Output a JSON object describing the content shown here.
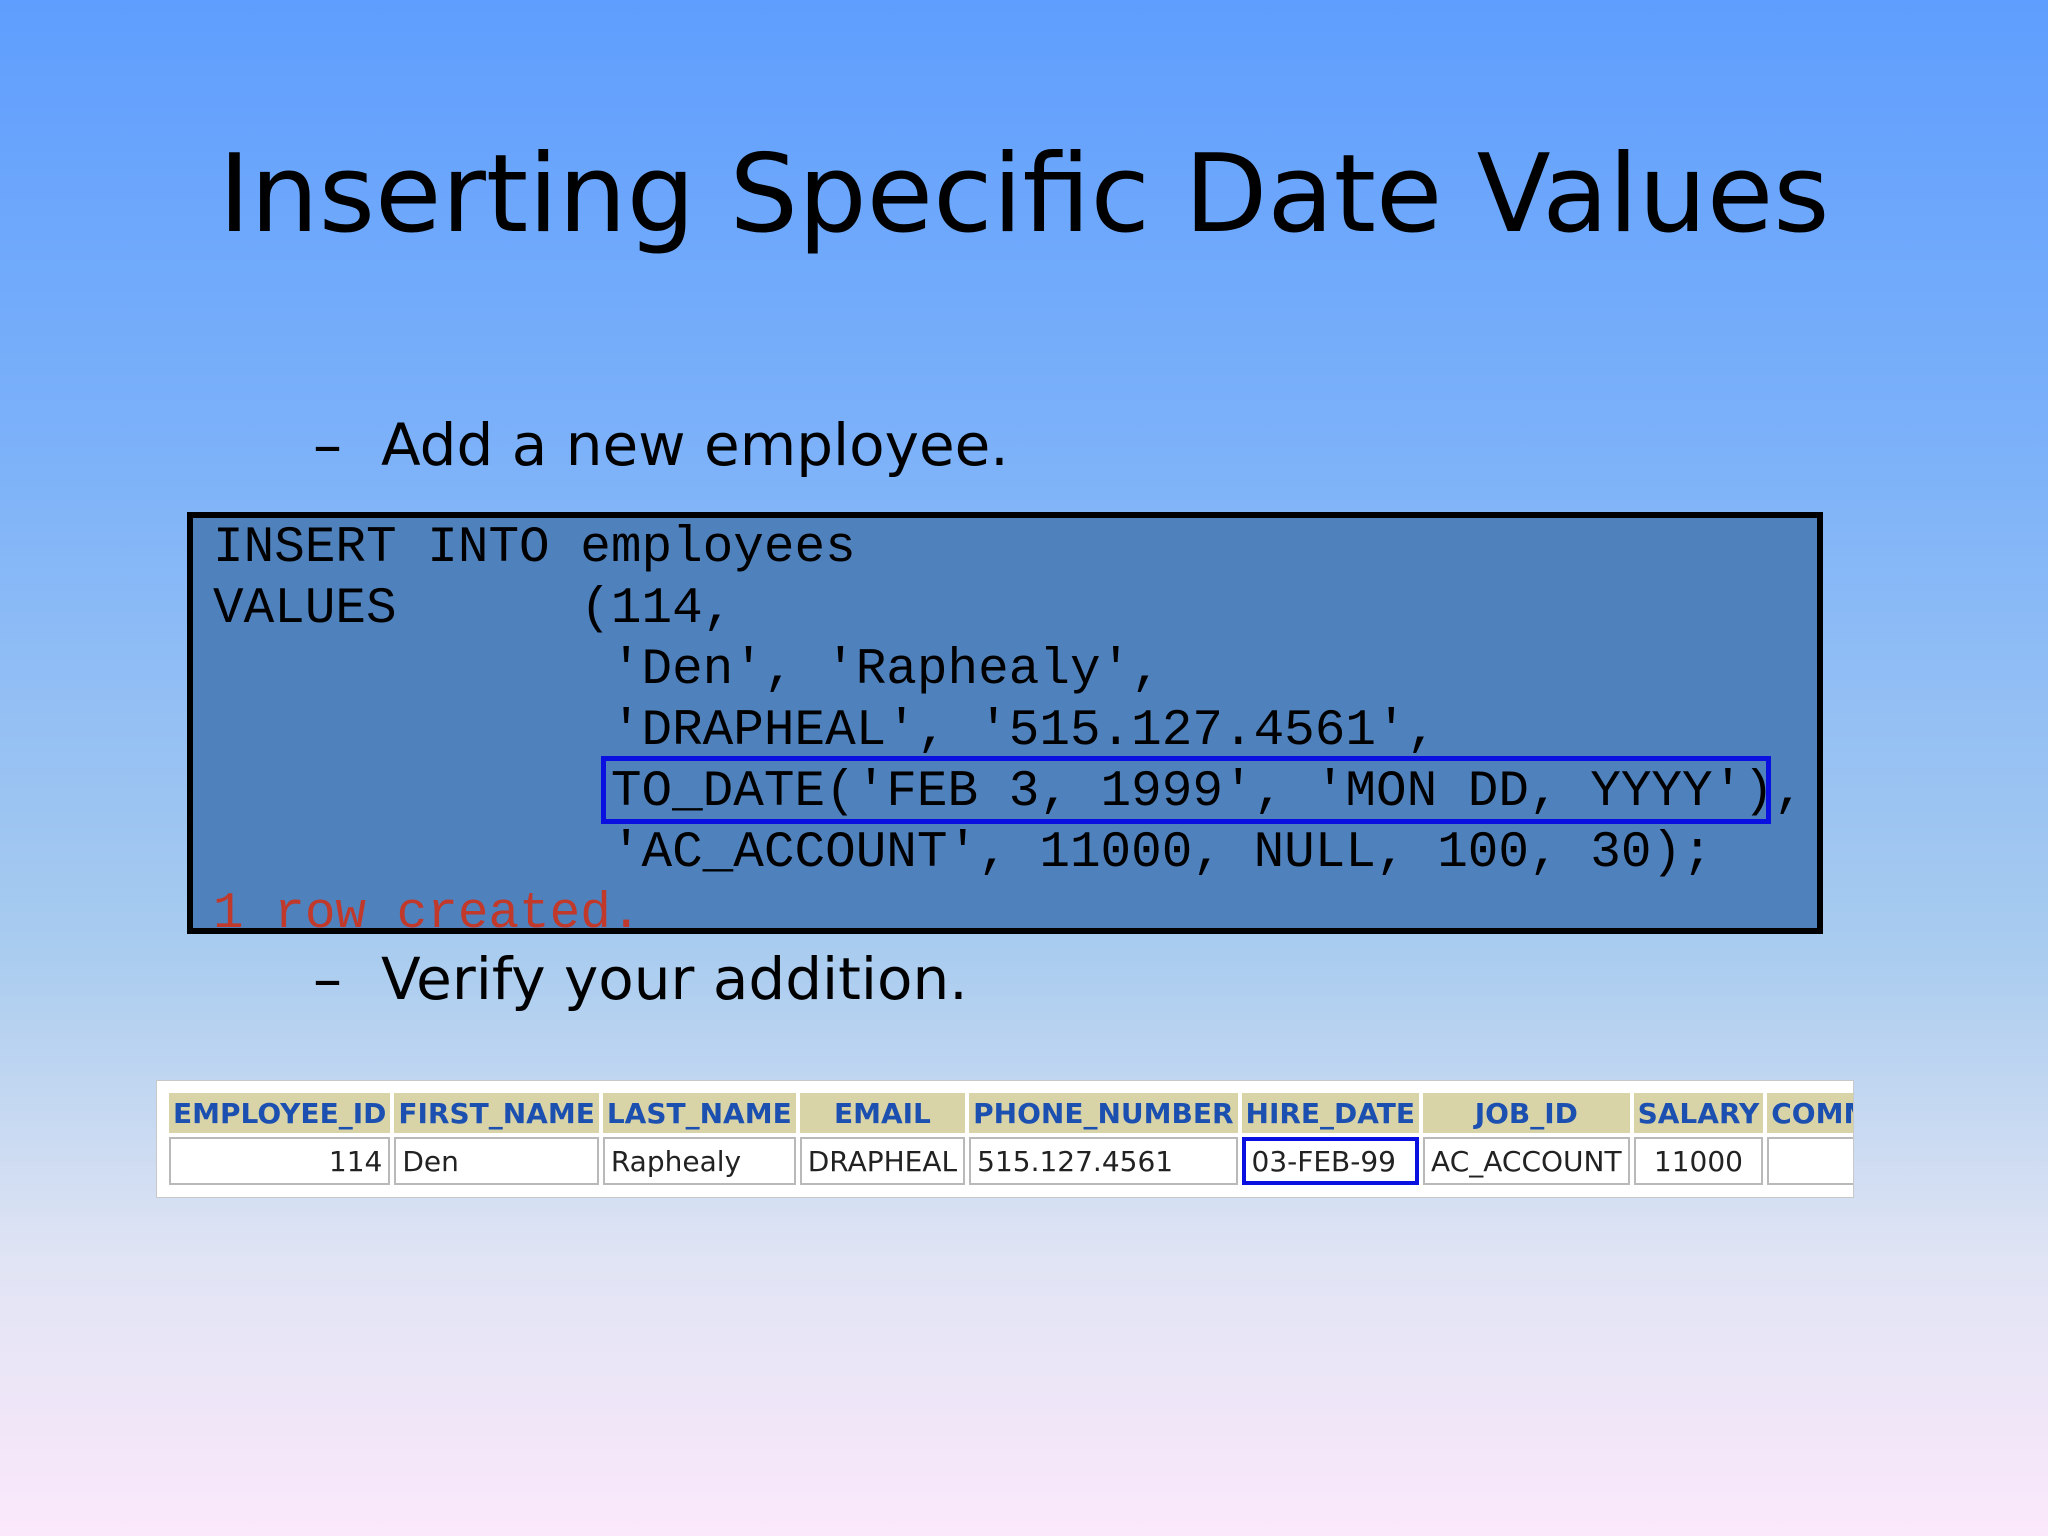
{
  "slide": {
    "title": "Inserting Specific Date Values",
    "bullets": [
      {
        "dash": "–",
        "text": "Add a new employee."
      },
      {
        "dash": "–",
        "text": "Verify your addition."
      }
    ]
  },
  "code": {
    "lines": [
      "INSERT INTO employees",
      "VALUES      (114,",
      "             'Den', 'Raphealy',",
      "             'DRAPHEAL', '515.127.4561',",
      "             TO_DATE('FEB 3, 1999', 'MON DD, YYYY'),",
      "             'AC_ACCOUNT', 11000, NULL, 100, 30);"
    ],
    "result_message": "1 row created.",
    "result_color": "#c0392b",
    "highlight_color": "#0a10e0"
  },
  "results_table": {
    "columns": [
      "EMPLOYEE_ID",
      "FIRST_NAME",
      "LAST_NAME",
      "EMAIL",
      "PHONE_NUMBER",
      "HIRE_DATE",
      "JOB_ID",
      "SALARY",
      "COMMISSION_P"
    ],
    "rows": [
      [
        "114",
        "Den",
        "Raphealy",
        "DRAPHEAL",
        "515.127.4561",
        "03-FEB-99",
        "AC_ACCOUNT",
        "11000",
        ""
      ]
    ],
    "header_bg": "#d9d3a8",
    "header_color": "#1b4fb0"
  }
}
